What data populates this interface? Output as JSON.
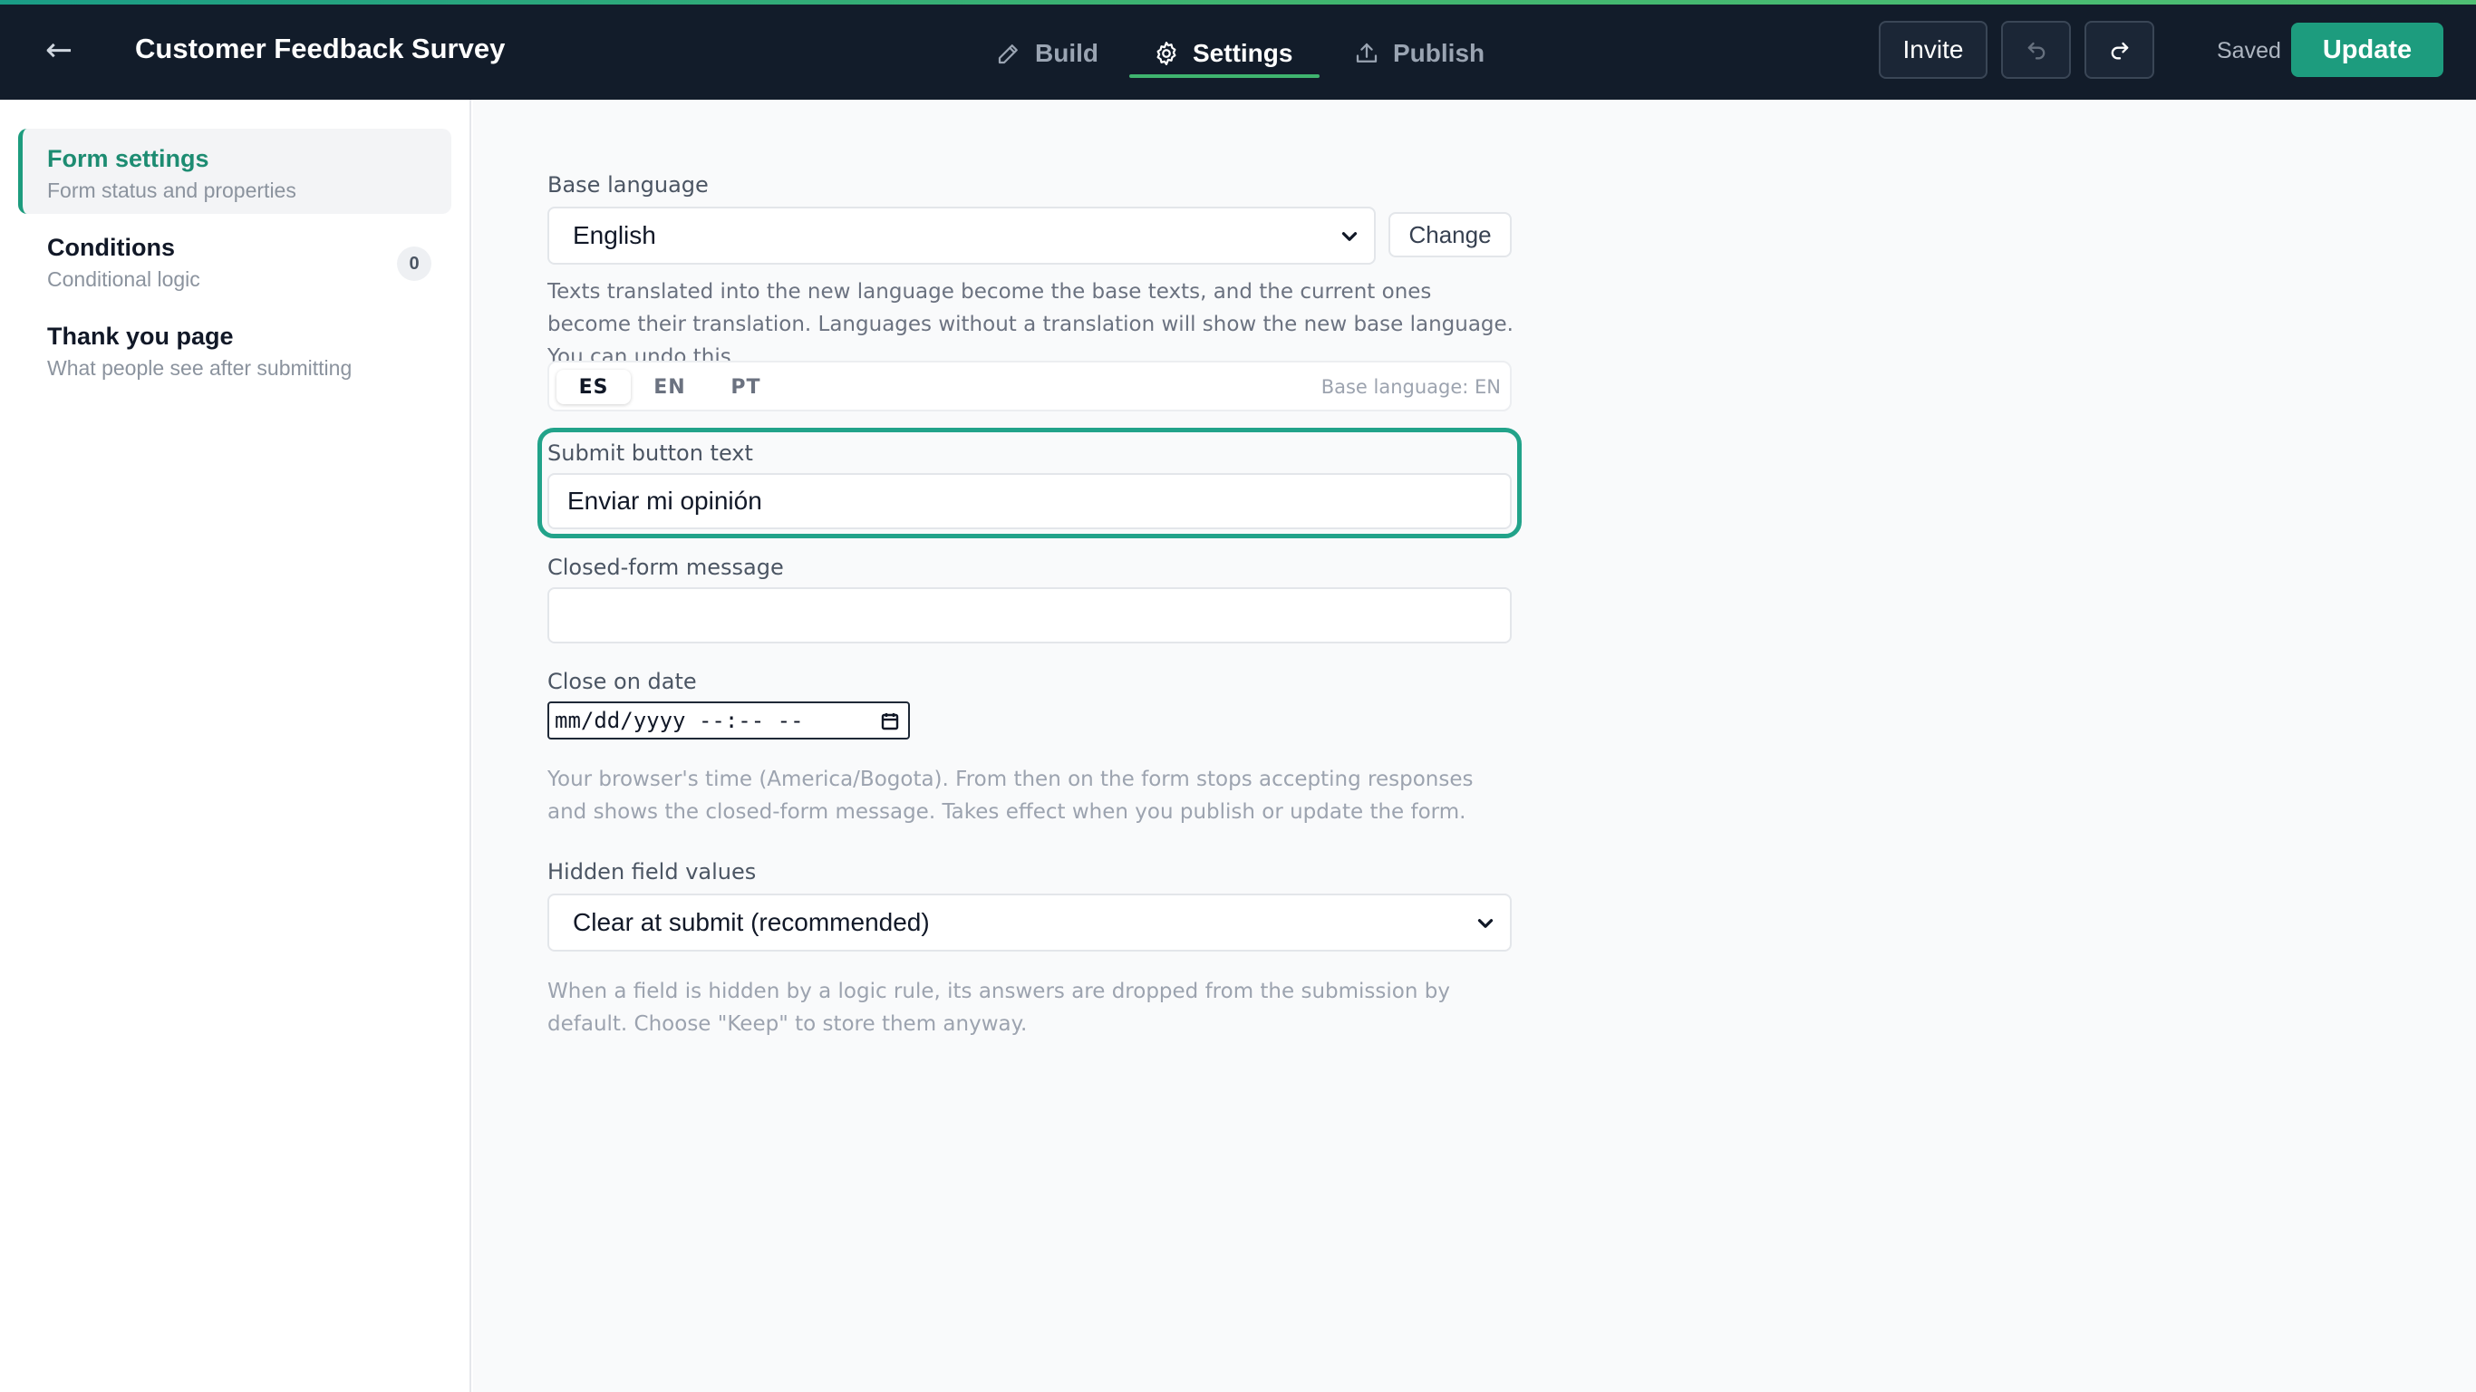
{
  "header": {
    "back_glyph": "←",
    "title": "Customer Feedback Survey",
    "tabs": [
      {
        "label": "Build",
        "icon": "pencil-icon"
      },
      {
        "label": "Settings",
        "icon": "gear-icon",
        "active": true
      },
      {
        "label": "Publish",
        "icon": "upload-icon"
      }
    ],
    "invite_label": "Invite",
    "saved_label": "Saved",
    "update_label": "Update",
    "accent_color": "#1d9c7e"
  },
  "sidebar": {
    "items": [
      {
        "label": "Form settings",
        "sub": "Form status and properties",
        "active": true
      },
      {
        "label": "Conditions",
        "sub": "Conditional logic",
        "badge": "0"
      },
      {
        "label": "Thank you page",
        "sub": "What people see after submitting"
      }
    ]
  },
  "settings": {
    "base_language": {
      "label": "Base language",
      "value": "English",
      "change_label": "Change",
      "help": "Texts translated into the new language become the base texts, and the current ones become their translation. Languages without a translation will show the new base language. You can undo this."
    },
    "language_tabs": [
      "ES",
      "EN",
      "PT"
    ],
    "active_language": "ES",
    "base_language_note": "Base language: EN",
    "submit_button": {
      "label": "Submit button text",
      "value": "Enviar mi opinión"
    },
    "closed_message": {
      "label": "Closed-form message",
      "value": ""
    },
    "close_date": {
      "label": "Close on date",
      "value": "mm/dd/yyyy --:-- --",
      "help": "Your browser's time (America/Bogota). From then on the form stops accepting responses and shows the closed-form message. Takes effect when you publish or update the form."
    },
    "hidden_fields": {
      "label": "Hidden field values",
      "value": "Clear at submit (recommended)",
      "help": "When a field is hidden by a logic rule, its answers are dropped from the submission by default. Choose \"Keep\" to store them anyway."
    }
  }
}
